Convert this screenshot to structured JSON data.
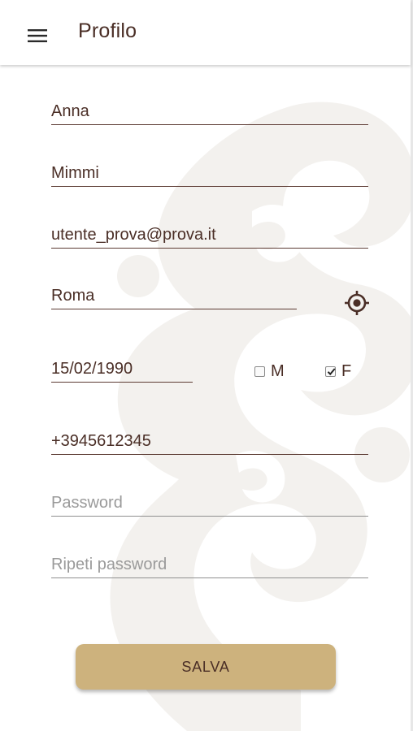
{
  "appbar": {
    "title": "Profilo",
    "menu_icon": "hamburger-menu-icon"
  },
  "form": {
    "first_name": "Anna",
    "last_name": "Mimmi",
    "email": "utente_prova@prova.it",
    "city": "Roma",
    "locate_icon": "location-target-icon",
    "birth_date": "15/02/1990",
    "gender": {
      "male_label": "M",
      "female_label": "F",
      "male_checked": false,
      "female_checked": true
    },
    "phone": "+3945612345",
    "password_placeholder": "Password",
    "repeat_password_placeholder": "Ripeti password",
    "save_label": "SALVA"
  },
  "colors": {
    "text": "#4a2e26",
    "button": "#cdb27d",
    "placeholder": "#9a9a9a"
  }
}
